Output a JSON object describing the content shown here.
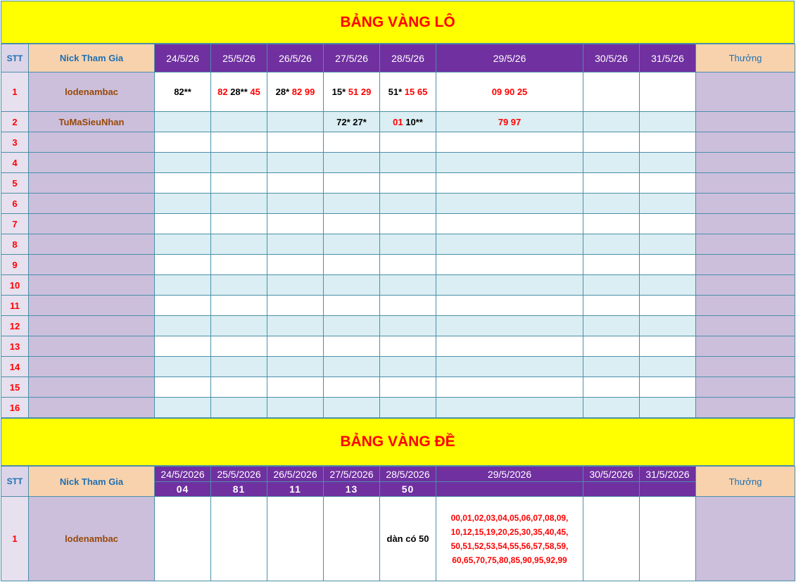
{
  "lo": {
    "title": "BẢNG VÀNG LÔ",
    "headers": {
      "stt": "STT",
      "nick": "Nick Tham Gia",
      "dates": [
        "24/5/26",
        "25/5/26",
        "26/5/26",
        "27/5/26",
        "28/5/26",
        "29/5/26",
        "30/5/26",
        "31/5/26"
      ],
      "reward": "Thưởng"
    },
    "rows": [
      {
        "stt": "1",
        "nick": "lodenambac",
        "cells": [
          [
            {
              "t": "82**",
              "c": "k"
            }
          ],
          [
            {
              "t": "82",
              "c": "r"
            },
            {
              "t": "28**",
              "c": "k"
            },
            {
              "t": "45",
              "c": "r"
            }
          ],
          [
            {
              "t": "28*",
              "c": "k"
            },
            {
              "t": "82 99",
              "c": "r"
            }
          ],
          [
            {
              "t": "15*",
              "c": "k"
            },
            {
              "t": "51 29",
              "c": "r"
            }
          ],
          [
            {
              "t": "51*",
              "c": "k"
            },
            {
              "t": "15 65",
              "c": "r"
            }
          ],
          [
            {
              "t": "09 90 25",
              "c": "r"
            }
          ],
          [],
          []
        ]
      },
      {
        "stt": "2",
        "nick": "TuMaSieuNhan",
        "cells": [
          [],
          [],
          [],
          [
            {
              "t": "72* 27*",
              "c": "k"
            }
          ],
          [
            {
              "t": "01",
              "c": "r"
            },
            {
              "t": "10**",
              "c": "k"
            }
          ],
          [
            {
              "t": "79 97",
              "c": "r"
            }
          ],
          [],
          []
        ]
      },
      {
        "stt": "3",
        "nick": "",
        "cells": []
      },
      {
        "stt": "4",
        "nick": "",
        "cells": []
      },
      {
        "stt": "5",
        "nick": "",
        "cells": []
      },
      {
        "stt": "6",
        "nick": "",
        "cells": []
      },
      {
        "stt": "7",
        "nick": "",
        "cells": []
      },
      {
        "stt": "8",
        "nick": "",
        "cells": []
      },
      {
        "stt": "9",
        "nick": "",
        "cells": []
      },
      {
        "stt": "10",
        "nick": "",
        "cells": []
      },
      {
        "stt": "11",
        "nick": "",
        "cells": []
      },
      {
        "stt": "12",
        "nick": "",
        "cells": []
      },
      {
        "stt": "13",
        "nick": "",
        "cells": []
      },
      {
        "stt": "14",
        "nick": "",
        "cells": []
      },
      {
        "stt": "15",
        "nick": "",
        "cells": []
      },
      {
        "stt": "16",
        "nick": "",
        "cells": []
      }
    ]
  },
  "de": {
    "title": "BẢNG VÀNG ĐỀ",
    "headers": {
      "stt": "STT",
      "nick": "Nick Tham Gia",
      "dates": [
        "24/5/2026",
        "25/5/2026",
        "26/5/2026",
        "27/5/2026",
        "28/5/2026",
        "29/5/2026",
        "30/5/2026",
        "31/5/2026"
      ],
      "results": [
        "04",
        "81",
        "11",
        "13",
        "50",
        "",
        "",
        ""
      ],
      "reward": "Thưởng"
    },
    "rows": [
      {
        "stt": "1",
        "nick": "lodenambac",
        "cells": [
          "",
          "",
          "",
          "",
          "dàn có 50",
          "00,01,02,03,04,05,06,07,08,09, 10,12,15,19,20,25,30,35,40,45, 50,51,52,53,54,55,56,57,58,59, 60,65,70,75,80,85,90,95,92,99",
          "",
          ""
        ]
      }
    ]
  }
}
